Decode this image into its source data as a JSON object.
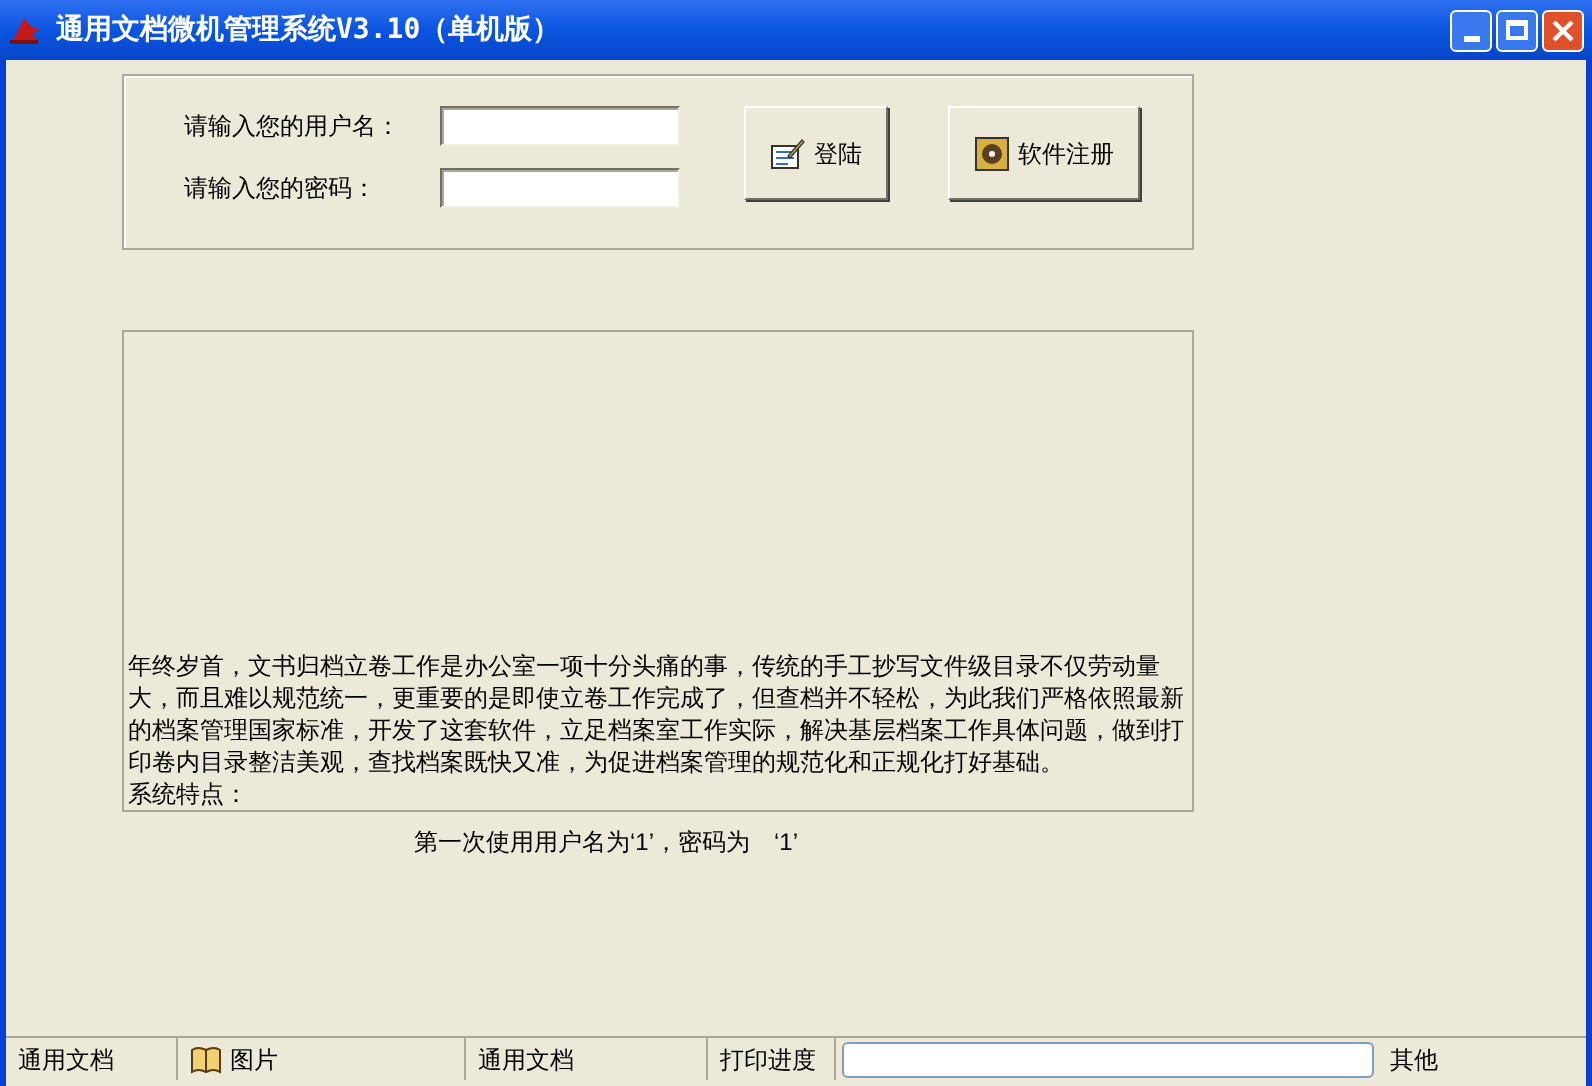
{
  "window": {
    "title": "通用文档微机管理系统V3.10（单机版）"
  },
  "login": {
    "fields": [
      {
        "label": "请输入您的用户名："
      },
      {
        "label": "请输入您的密码："
      }
    ],
    "buttons": [
      {
        "label": "登陆",
        "kind": "login"
      },
      {
        "label": "软件注册",
        "kind": "register"
      }
    ]
  },
  "description": {
    "paragraphs": [
      "年终岁首，文书归档立卷工作是办公室一项十分头痛的事，传统的手工抄写文件级目录不仅劳动量大，而且难以规范统一，更重要的是即使立卷工作完成了，但查档并不轻松，为此我们严格依照最新的档案管理国家标准，开发了这套软件，立足档案室工作实际，解决基层档案工作具体问题，做到打印卷内目录整洁美观，查找档案既快又准，为促进档案管理的规范化和正规化打好基础。",
      "系统特点："
    ]
  },
  "hint": "第一次使用用户名为‘1’，密码为　‘1’",
  "status_bar": {
    "panels": [
      {
        "text": "通用文档",
        "kind": "text"
      },
      {
        "text": "图片",
        "kind": "icon"
      },
      {
        "text": "通用文档",
        "kind": "text"
      },
      {
        "text": "打印进度",
        "kind": "text"
      }
    ],
    "progress": {
      "level": 0
    },
    "other": "其他"
  }
}
